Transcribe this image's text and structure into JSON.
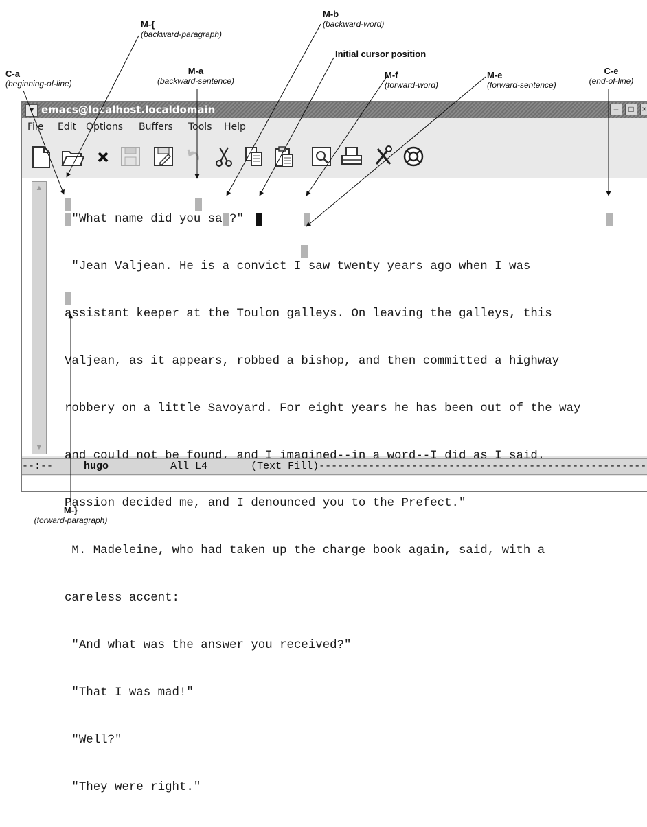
{
  "callouts": {
    "beginning_of_line": {
      "key": "C-a",
      "command": "(beginning-of-line)"
    },
    "backward_paragraph": {
      "key": "M-{",
      "command": "(backward-paragraph)"
    },
    "backward_sentence": {
      "key": "M-a",
      "command": "(backward-sentence)"
    },
    "backward_word": {
      "key": "M-b",
      "command": "(backward-word)"
    },
    "initial_cursor": {
      "key": "Initial cursor position"
    },
    "forward_word": {
      "key": "M-f",
      "command": "(forward-word)"
    },
    "forward_sentence": {
      "key": "M-e",
      "command": "(forward-sentence)"
    },
    "end_of_line": {
      "key": "C-e",
      "command": "(end-of-line)"
    },
    "forward_paragraph": {
      "key": "M-}",
      "command": "(forward-paragraph)"
    }
  },
  "window": {
    "title": "emacs@localhost.localdomain",
    "menu_icon": "chevron-down-icon"
  },
  "menu": [
    "File",
    "Edit",
    "Options",
    "Buffers",
    "Tools",
    "Help"
  ],
  "toolbar": [
    "new-file-icon",
    "open-folder-icon",
    "close-x-icon",
    "save-disk-icon",
    "save-as-icon",
    "undo-icon",
    "cut-scissors-icon",
    "copy-icon",
    "paste-icon",
    "search-icon",
    "print-icon",
    "preferences-icon",
    "help-lifebuoy-icon"
  ],
  "buffer": {
    "lines": [
      " \"What name did you say?\"",
      " \"Jean Valjean. He is a convict I saw twenty years ago when I was",
      "assistant keeper at the Toulon galleys. On leaving the galleys, this",
      "Valjean, as it appears, robbed a bishop, and then committed a highway",
      "robbery on a little Savoyard. For eight years he has been out of the way",
      "and could not be found, and I imagined--in a word--I did as I said.",
      "Passion decided me, and I denounced you to the Prefect.\"",
      " M. Madeleine, who had taken up the charge book again, said, with a",
      "careless accent:",
      " \"And what was the answer you received?\"",
      " \"That I was mad!\"",
      " \"Well?\"",
      " \"They were right.\""
    ]
  },
  "modeline": {
    "prefix": "--:--  ",
    "buffer_name": "hugo",
    "position": "All L4",
    "mode": "(Text Fill)"
  }
}
